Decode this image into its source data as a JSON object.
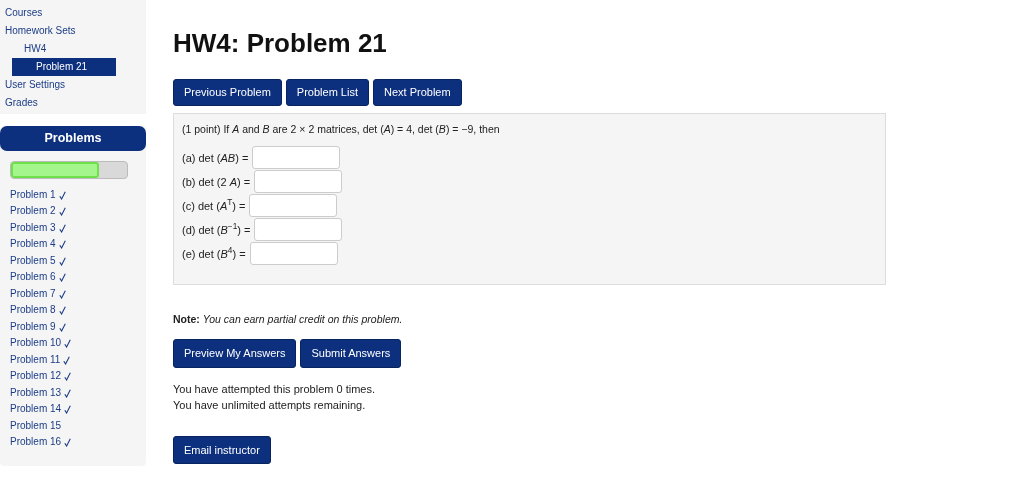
{
  "nav": [
    {
      "label": "Courses",
      "selected": false
    },
    {
      "label": "Homework Sets",
      "selected": false,
      "children": [
        {
          "label": "HW4",
          "selected": false,
          "children": [
            {
              "label": "Problem 21",
              "selected": true
            }
          ]
        }
      ]
    },
    {
      "label": "User Settings",
      "selected": false
    },
    {
      "label": "Grades",
      "selected": false
    }
  ],
  "problems_panel": {
    "title": "Problems",
    "progress": {
      "level": 0.76
    },
    "items": [
      {
        "label": "Problem 1",
        "done": true
      },
      {
        "label": "Problem 2",
        "done": true
      },
      {
        "label": "Problem 3",
        "done": true
      },
      {
        "label": "Problem 4",
        "done": true
      },
      {
        "label": "Problem 5",
        "done": true
      },
      {
        "label": "Problem 6",
        "done": true
      },
      {
        "label": "Problem 7",
        "done": true
      },
      {
        "label": "Problem 8",
        "done": true
      },
      {
        "label": "Problem 9",
        "done": true
      },
      {
        "label": "Problem 10",
        "done": true
      },
      {
        "label": "Problem 11",
        "done": true
      },
      {
        "label": "Problem 12",
        "done": true
      },
      {
        "label": "Problem 13",
        "done": true
      },
      {
        "label": "Problem 14",
        "done": true
      },
      {
        "label": "Problem 15",
        "done": false
      },
      {
        "label": "Problem 16",
        "done": true
      }
    ]
  },
  "title": "HW4: Problem 21",
  "nav_buttons": [
    "Previous Problem",
    "Problem List",
    "Next Problem"
  ],
  "problem": {
    "statement": "(1 point) If *A* and *B* are 2 × 2 matrices, det (*A*) = 4, det (*B*) = −9, then",
    "parts": [
      {
        "label": "(a) det (*AB*) ="
      },
      {
        "label": "(b) det (2 *A*) ="
      },
      {
        "label": "(c) det (*A*$^{T}$) ="
      },
      {
        "label": "(d) det (*B*$^{−1}$) ="
      },
      {
        "label": "(e) det (*B*$^{4}$) ="
      }
    ]
  },
  "note": "**Note:** *You can earn partial credit on this problem.*",
  "answer_buttons": [
    "Preview My Answers",
    "Submit Answers"
  ],
  "attempts": [
    "You have attempted this problem 0 times.",
    "You have unlimited attempts remaining."
  ],
  "email_button": "Email instructor"
}
